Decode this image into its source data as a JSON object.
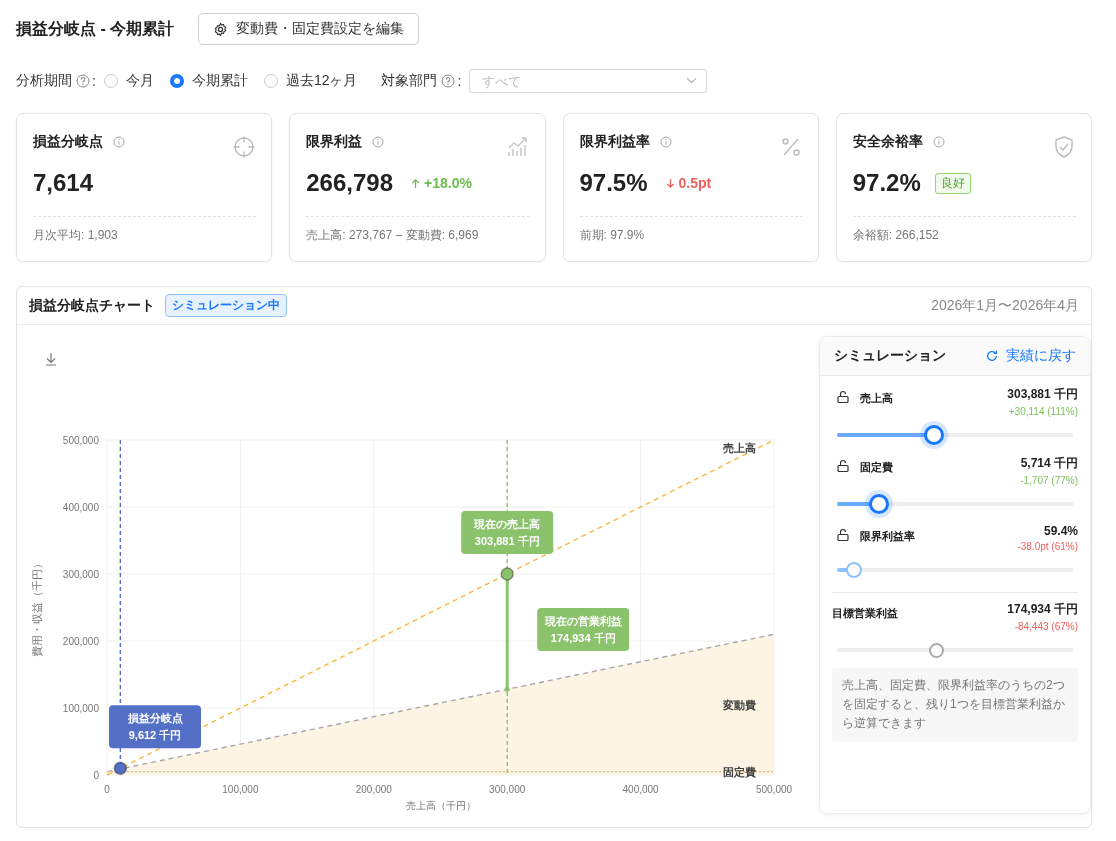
{
  "page": {
    "title": "損益分岐点 - 今期累計",
    "edit_button": "変動費・固定費設定を編集"
  },
  "filters": {
    "period_label": "分析期間",
    "period_suffix": ":",
    "period_options": [
      {
        "label": "今月",
        "selected": false
      },
      {
        "label": "今期累計",
        "selected": true
      },
      {
        "label": "過去12ヶ月",
        "selected": false
      }
    ],
    "department_label": "対象部門",
    "department_suffix": ":",
    "department": {
      "placeholder": "すべて"
    }
  },
  "cards": [
    {
      "title": "損益分岐点",
      "value": "7,614",
      "footer": "月次平均: 1,903"
    },
    {
      "title": "限界利益",
      "value": "266,798",
      "delta": {
        "text": "+18.0%",
        "up": true
      },
      "footer": "売上高: 273,767 – 変動費: 6,969"
    },
    {
      "title": "限界利益率",
      "value": "97.5%",
      "delta": {
        "text": "0.5pt",
        "up": false
      },
      "footer": "前期: 97.9%"
    },
    {
      "title": "安全余裕率",
      "value": "97.2%",
      "badge": "良好",
      "footer": "余裕額: 266,152"
    }
  ],
  "chart_panel": {
    "title": "損益分岐点チャート",
    "badge": "シミュレーション中",
    "period": "2026年1月〜2026年4月",
    "chart_data": {
      "type": "line",
      "xlabel": "売上高（千円）",
      "ylabel": "費用・収益（千円）",
      "x": [
        0,
        500000
      ],
      "series": [
        {
          "name": "売上高",
          "color": "#f5b942",
          "line_style": "dashed",
          "values": [
            0,
            500000
          ]
        },
        {
          "name": "変動費",
          "color": "#a8a8a8",
          "line_style": "dashed",
          "values": [
            5000,
            210000
          ]
        },
        {
          "name": "固定費",
          "color": "#d9b77a",
          "line_style": "dotted",
          "values": [
            5000,
            5000
          ]
        }
      ],
      "xlim": [
        0,
        500000
      ],
      "ylim": [
        0,
        500000
      ],
      "grid": true,
      "xticks": [
        {
          "value": 0,
          "label": "0"
        },
        {
          "value": 100000,
          "label": "100,000"
        },
        {
          "value": 200000,
          "label": "200,000"
        },
        {
          "value": 300000,
          "label": "300,000"
        },
        {
          "value": 400000,
          "label": "400,000"
        },
        {
          "value": 500000,
          "label": "500,000"
        }
      ],
      "yticks": [
        {
          "value": 0,
          "label": "0"
        },
        {
          "value": 100000,
          "label": "100,000"
        },
        {
          "value": 200000,
          "label": "200,000"
        },
        {
          "value": 300000,
          "label": "300,000"
        },
        {
          "value": 400000,
          "label": "400,000"
        },
        {
          "value": 500000,
          "label": "500,000"
        }
      ],
      "ref_lines": [
        {
          "axis": "x",
          "value": 10000,
          "color": "#5470c6"
        },
        {
          "axis": "x",
          "value": 300000,
          "color": "#8bc26c"
        }
      ]
    },
    "callouts": [
      {
        "title": "損益分岐点",
        "value": "9,612 千円",
        "color": "#5470c6"
      },
      {
        "title": "現在の売上高",
        "value": "303,881 千円",
        "color": "#8bc26c"
      },
      {
        "title": "現在の営業利益",
        "value": "174,934 千円",
        "color": "#8bc26c"
      }
    ]
  },
  "simulation": {
    "title": "シミュレーション",
    "reset_button": "実績に戻す",
    "items": [
      {
        "kind": "input",
        "label": "売上高",
        "locked": false,
        "value": "303,881 千円",
        "delta": "+30,114 (111%)",
        "favorable": true,
        "level": 0.41,
        "highlighted": true
      },
      {
        "kind": "input",
        "label": "固定費",
        "locked": false,
        "value": "5,714 千円",
        "delta": "-1,707 (77%)",
        "favorable": true,
        "level": 0.18,
        "highlighted": true
      },
      {
        "kind": "input",
        "label": "限界利益率",
        "locked": false,
        "value": "59.4%",
        "delta": "-38.0pt (61%)",
        "favorable": false,
        "level": 0.07,
        "highlighted": false
      },
      {
        "kind": "target",
        "label": "目標営業利益",
        "value": "174,934 千円",
        "delta": "-84,443 (67%)",
        "favorable": false,
        "level": 0.42
      }
    ],
    "note": "売上高、固定費、限界利益率のうちの2つを固定すると、残り1つを目標営業利益から逆算できます"
  }
}
